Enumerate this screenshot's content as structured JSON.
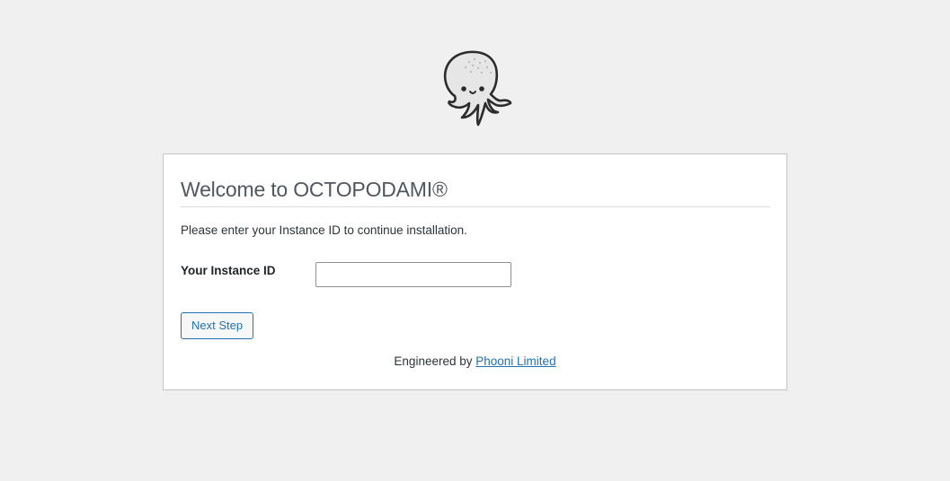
{
  "logo": {
    "icon": "octopus-mascot-icon"
  },
  "card": {
    "title": "Welcome to OCTOPODAMI®",
    "intro": "Please enter your Instance ID to continue installation.",
    "instance_field": {
      "label": "Your Instance ID",
      "value": "",
      "placeholder": ""
    },
    "next_button": "Next Step",
    "footer": {
      "prefix": "Engineered by",
      "link_text": "Phooni Limited"
    }
  },
  "colors": {
    "background": "#f0f0f1",
    "card_border": "#c3c4c7",
    "link": "#2271b1",
    "title": "#50575e"
  }
}
